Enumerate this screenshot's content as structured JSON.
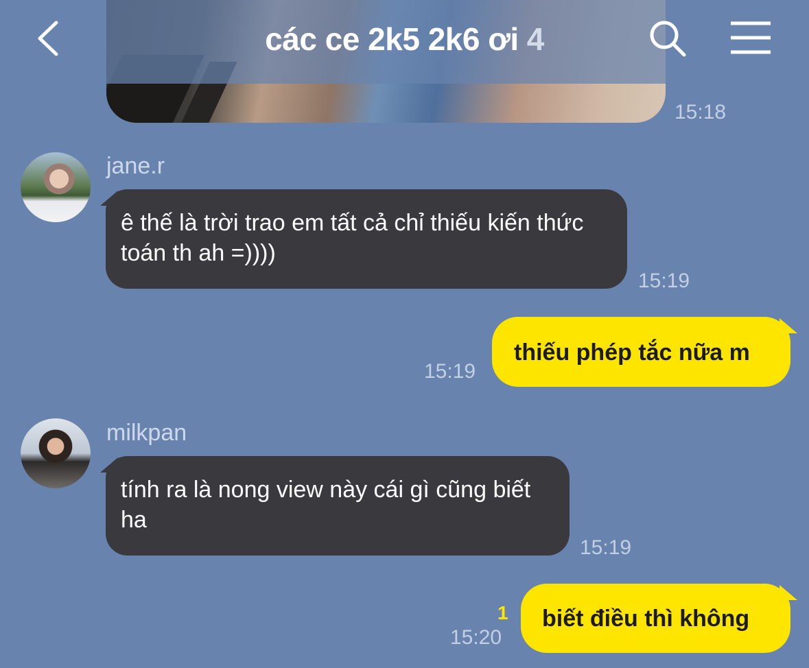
{
  "header": {
    "title": "các ce 2k5 2k6 ơi",
    "member_count": "4",
    "back_icon": "chevron-left-icon",
    "search_icon": "search-icon",
    "menu_icon": "menu-icon"
  },
  "messages": [
    {
      "type": "image",
      "time": "15:18"
    },
    {
      "sender": "jane.r",
      "text": "ê thế là trời trao em tất cả chỉ thiếu kiến thức toán th ah =))))",
      "time": "15:19"
    },
    {
      "sender": "me",
      "text": "thiếu phép tắc nữa m",
      "time": "15:19"
    },
    {
      "sender": "milkpan",
      "text": "tính ra là nong view này cái gì cũng biết ha",
      "time": "15:19"
    },
    {
      "sender": "me",
      "text": "biết điều thì không",
      "time": "15:20",
      "unread": "1"
    }
  ],
  "colors": {
    "background": "#6884AE",
    "incoming_bubble": "#3A393D",
    "outgoing_bubble": "#FDE500"
  }
}
